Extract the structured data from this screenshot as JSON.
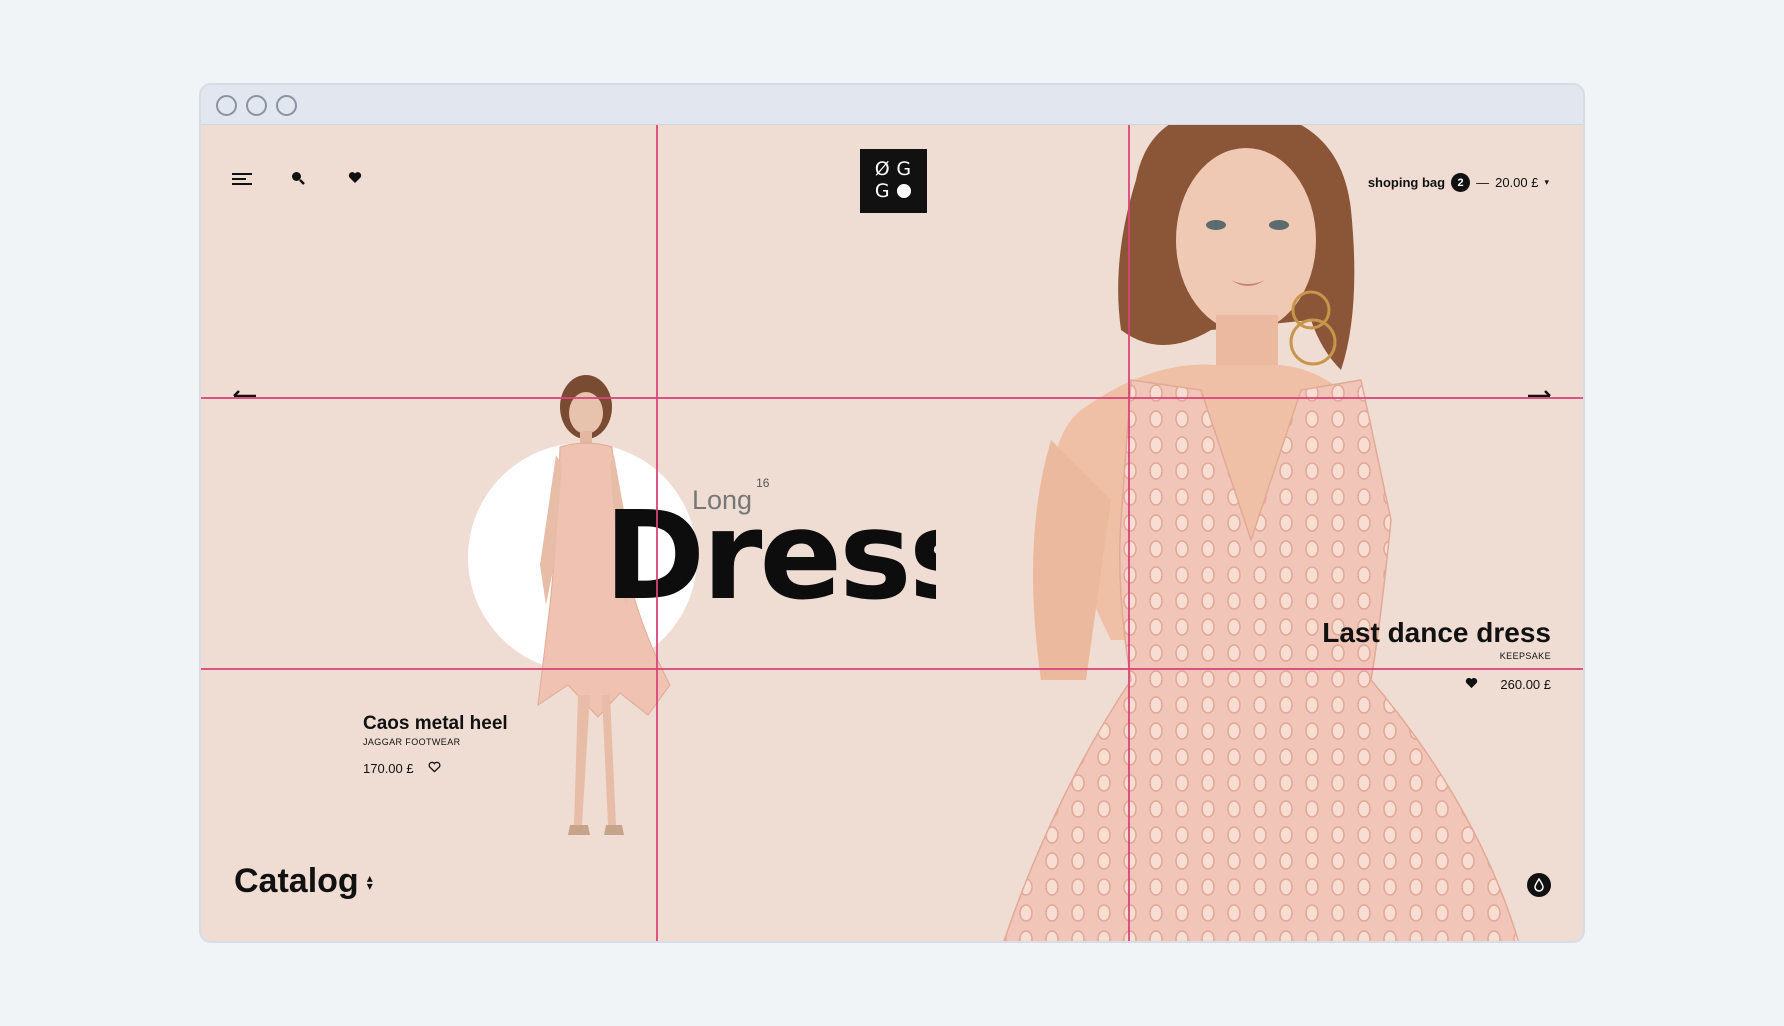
{
  "logo": {
    "tl": "Ø",
    "tr": "G",
    "bl": "G"
  },
  "header": {
    "bag_label": "shoping bag",
    "bag_count": "2",
    "bag_separator": "—",
    "bag_total": "20.00 £"
  },
  "hero": {
    "small_title": "Long",
    "small_sup": "16",
    "big_title": "Dresse"
  },
  "product_left": {
    "name": "Caos metal heel",
    "brand": "JAGGAR FOOTWEAR",
    "price": "170.00  £"
  },
  "product_right": {
    "name": "Last dance dress",
    "brand": "KEEPSAKE",
    "price": "260.00  £"
  },
  "footer": {
    "catalog_label": "Catalog"
  },
  "icons": {
    "menu": "menu-icon",
    "search": "search-icon",
    "wishlist": "heart-icon",
    "prev": "arrow-left-icon",
    "next": "arrow-right-icon",
    "drop": "drop-icon"
  },
  "colors": {
    "background": "#efddd3",
    "guide_lines": "#d8457a",
    "ink": "#111111",
    "window_bg": "#f0f4f7"
  }
}
